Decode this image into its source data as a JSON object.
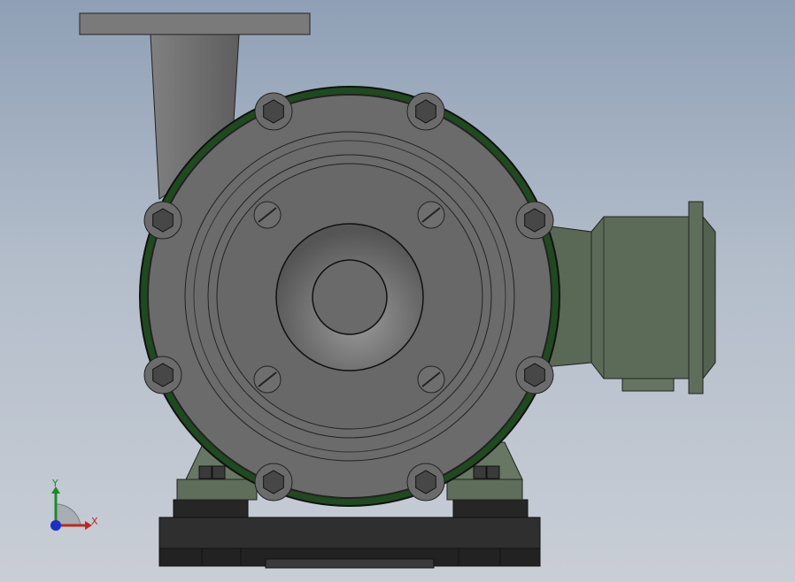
{
  "viewport": {
    "background_top": "#8fa0b6",
    "background_bottom": "#c9ced6"
  },
  "model": {
    "casing_color": "#6b6b6b",
    "motor_color": "#5c6b58",
    "seal_color": "#1f4a1f",
    "base_color": "#2e2e2e",
    "discharge_color": "#7a7a7a"
  },
  "triad": {
    "x_label": "X",
    "y_label": "Y",
    "x_color": "#c0281e",
    "y_color": "#1f8a2a",
    "z_color": "#1a2fc8"
  }
}
